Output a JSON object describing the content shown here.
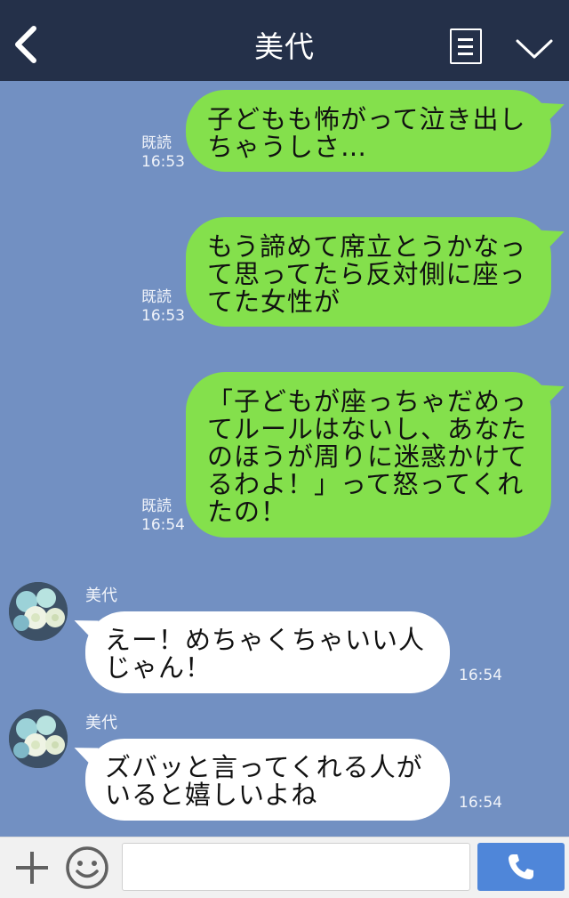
{
  "header": {
    "title": "美代",
    "icons": {
      "back": "chevron-left-icon",
      "menu": "menu-list-icon",
      "more": "chevron-down-icon"
    }
  },
  "messages": [
    {
      "direction": "outgoing",
      "text_lines": [
        "子どもも怖がって泣き出し",
        "ちゃうしさ…"
      ],
      "read_label": "既読",
      "time": "16:53"
    },
    {
      "direction": "outgoing",
      "text_lines": [
        "もう諦めて席立とうかなっ",
        "て思ってたら反対側に座っ",
        "てた女性が"
      ],
      "read_label": "既読",
      "time": "16:53"
    },
    {
      "direction": "outgoing",
      "text_lines": [
        "「子どもが座っちゃだめっ",
        "てルールはないし、あなた",
        "のほうが周りに迷惑かけて",
        "るわよ！」って怒ってくれ",
        "たの！"
      ],
      "read_label": "既読",
      "time": "16:54"
    },
    {
      "direction": "incoming",
      "sender": "美代",
      "text_lines": [
        "えー！めちゃくちゃいい人",
        "じゃん！"
      ],
      "time": "16:54"
    },
    {
      "direction": "incoming",
      "sender": "美代",
      "text_lines": [
        "ズバッと言ってくれる人が",
        "いると嬉しいよね"
      ],
      "time": "16:54"
    }
  ],
  "footer": {
    "input_value": "",
    "icons": {
      "add": "plus-icon",
      "emoji": "smiley-icon",
      "call": "phone-icon"
    }
  },
  "colors": {
    "header_bg": "#243049",
    "chat_bg": "#7290c2",
    "outgoing_bubble": "#84e04c",
    "incoming_bubble": "#ffffff",
    "call_button": "#4f86d9"
  }
}
